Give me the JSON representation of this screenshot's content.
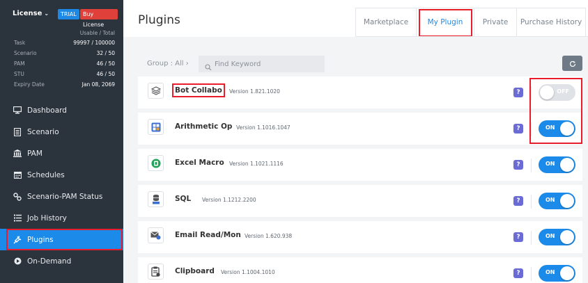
{
  "license": {
    "label": "License",
    "trial_badge": "TRIAL",
    "buy_button": "Buy License",
    "usage_header": "Usable / Total",
    "rows": [
      {
        "key": "Task",
        "value": "99997 / 100000"
      },
      {
        "key": "Scenario",
        "value": "32 / 50"
      },
      {
        "key": "PAM",
        "value": "46 / 50"
      },
      {
        "key": "STU",
        "value": "46 / 50"
      },
      {
        "key": "Expiry Date",
        "value": "Jan 08, 2069"
      }
    ]
  },
  "nav": [
    {
      "label": "Dashboard",
      "icon": "monitor-icon"
    },
    {
      "label": "Scenario",
      "icon": "list-icon"
    },
    {
      "label": "PAM",
      "icon": "bank-icon"
    },
    {
      "label": "Schedules",
      "icon": "calendar-icon"
    },
    {
      "label": "Scenario-PAM Status",
      "icon": "link-icon"
    },
    {
      "label": "Job History",
      "icon": "history-icon"
    },
    {
      "label": "Plugins",
      "icon": "plug-icon",
      "active": true
    },
    {
      "label": "On-Demand",
      "icon": "play-circle-icon"
    }
  ],
  "header": {
    "title": "Plugins"
  },
  "tabs": [
    "Marketplace",
    "My Plugin",
    "Private",
    "Purchase History"
  ],
  "filter": {
    "group": "Group : All",
    "search_placeholder": "Find Keyword"
  },
  "plugins": [
    {
      "name": "Bot Collabo",
      "version": "Version 1.821.1020",
      "state": "OFF",
      "icon": "layers-icon"
    },
    {
      "name": "Arithmetic Op",
      "version": "Version 1.1016.1047",
      "state": "ON",
      "icon": "calculator-icon"
    },
    {
      "name": "Excel Macro",
      "version": "Version 1.1021.1116",
      "state": "ON",
      "icon": "excel-icon"
    },
    {
      "name": "SQL",
      "version": "Version 1.1212.2200",
      "state": "ON",
      "icon": "database-icon"
    },
    {
      "name": "Email Read/Mon",
      "version": "Version 1.620.938",
      "state": "ON",
      "icon": "email-icon"
    },
    {
      "name": "Clipboard",
      "version": "Version 1.1004.1010",
      "state": "ON",
      "icon": "clipboard-icon"
    }
  ],
  "help_label": "?",
  "colors": {
    "accent": "#1b8ae8",
    "sidebar": "#2b333d",
    "highlight": "#e81c2a",
    "help": "#6b6bd6"
  }
}
